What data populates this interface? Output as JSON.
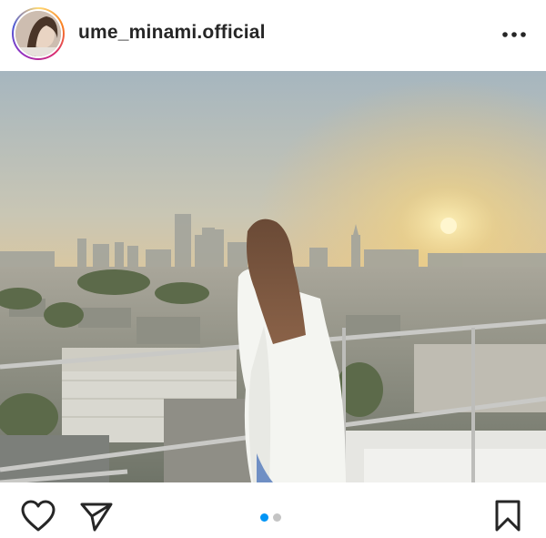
{
  "post": {
    "username": "ume_minami.official",
    "more_icon": "more-horizontal-icon",
    "photo_description_icon": "photo",
    "carousel": {
      "current": 1,
      "total": 2
    },
    "actions": {
      "like_icon": "heart-icon",
      "share_icon": "paper-plane-icon",
      "save_icon": "bookmark-icon"
    }
  },
  "colors": {
    "text": "#262626",
    "dot_active": "#0095f6",
    "dot_inactive": "#c4c4c4"
  }
}
